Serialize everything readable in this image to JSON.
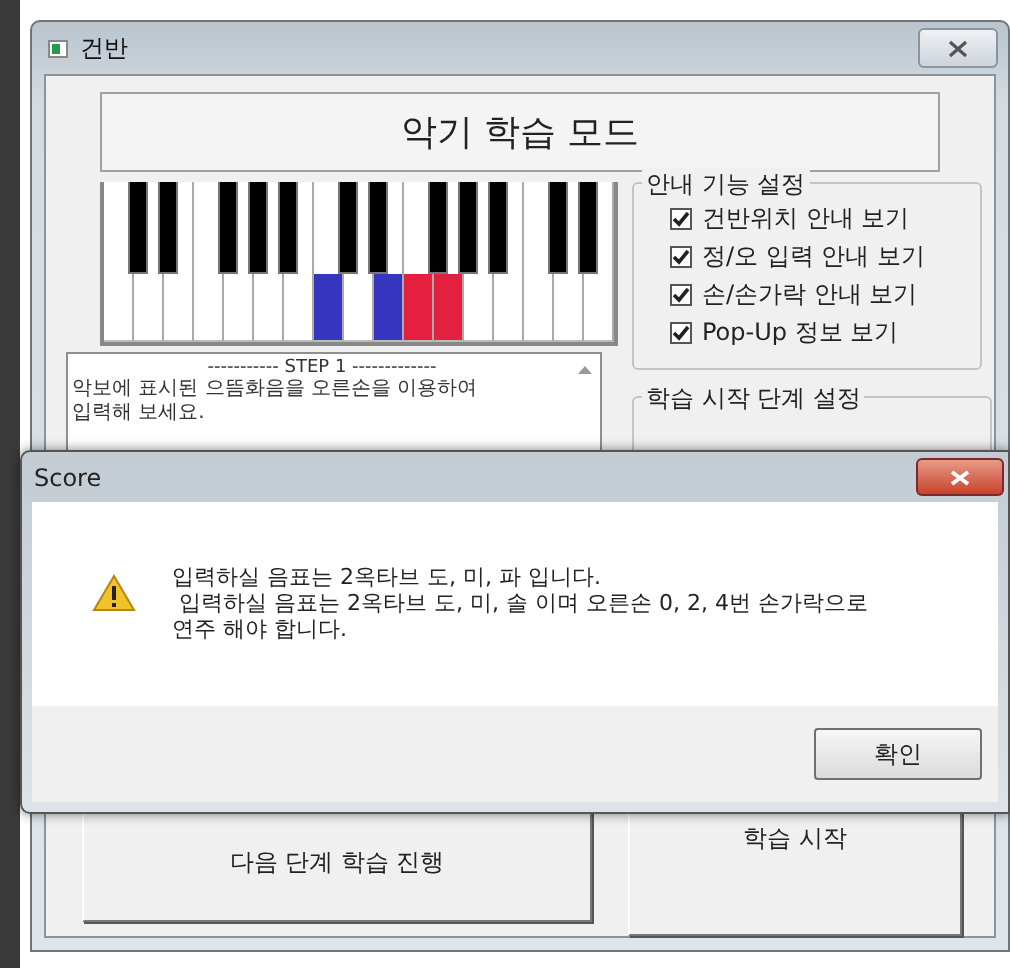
{
  "main_window": {
    "title": "건반",
    "heading": "악기 학습 모드",
    "piano": {
      "white_keys": [
        {
          "color": "#ffffff"
        },
        {
          "color": "#ffffff"
        },
        {
          "color": "#ffffff"
        },
        {
          "color": "#ffffff"
        },
        {
          "color": "#ffffff"
        },
        {
          "color": "#ffffff"
        },
        {
          "color": "#ffffff"
        },
        {
          "color": "#3535c0"
        },
        {
          "color": "#ffffff"
        },
        {
          "color": "#3535c0"
        },
        {
          "color": "#e3203f"
        },
        {
          "color": "#e3203f"
        },
        {
          "color": "#ffffff"
        },
        {
          "color": "#ffffff"
        },
        {
          "color": "#ffffff"
        },
        {
          "color": "#ffffff"
        },
        {
          "color": "#ffffff"
        }
      ]
    },
    "step_panel": {
      "header": "----------- STEP 1 -------------",
      "text_lines": [
        "악보에 표시된 으뜸화음을 오른손을 이용하여",
        "입력해 보세요."
      ]
    },
    "guide_settings": {
      "title": "안내 기능 설정",
      "options": [
        {
          "label": "건반위치 안내 보기",
          "checked": true
        },
        {
          "label": "정/오 입력 안내 보기",
          "checked": true
        },
        {
          "label": "손/손가락 안내 보기",
          "checked": true
        },
        {
          "label": "Pop-Up 정보 보기",
          "checked": true
        }
      ]
    },
    "start_step_settings": {
      "title": "학습 시작 단계 설정"
    },
    "buttons": [
      "다음 단계 학습 진행",
      "학습 시작"
    ]
  },
  "dialog": {
    "title": "Score",
    "message_lines": [
      "입력하실 음표는 2옥타브 도, 미, 파 입니다.",
      " 입력하실 음표는 2옥타브 도, 미, 솔 이며 오른손 0, 2, 4번 손가락으로",
      "연주 해야 합니다."
    ],
    "buttons": [
      "확인"
    ]
  }
}
